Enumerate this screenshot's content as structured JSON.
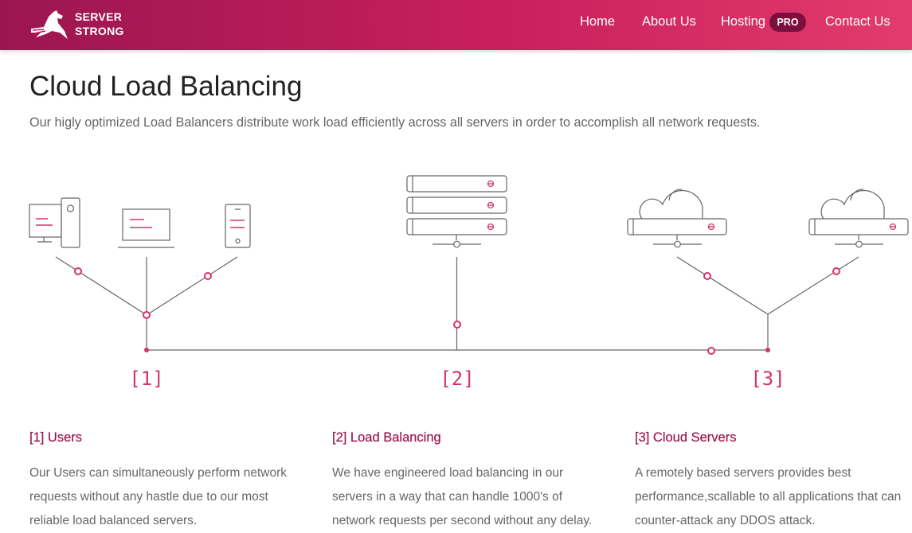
{
  "brand": {
    "line1": "SERVER",
    "line2": "STRONG"
  },
  "nav": {
    "home": "Home",
    "about": "About Us",
    "hosting": "Hosting",
    "hosting_badge": "PRO",
    "contact": "Contact Us"
  },
  "hero": {
    "title": "Cloud Load Balancing",
    "subtitle": "Our higly optimized Load Balancers distribute work load efficiently across all servers in order to accomplish all network requests."
  },
  "diagram": {
    "markers": [
      "[1]",
      "[2]",
      "[3]"
    ],
    "icons": [
      "desktop-icon",
      "laptop-icon",
      "mobile-icon",
      "server-rack-icon",
      "cloud-server-icon"
    ],
    "colors": {
      "accent": "#d6336c",
      "line": "#666666",
      "brand_dark": "#9b1650"
    }
  },
  "sections": [
    {
      "heading": "[1] Users",
      "body": "Our Users can simultaneously perform network requests without any hastle due to our most reliable load balanced servers."
    },
    {
      "heading": "[2] Load Balancing",
      "body": "We have engineered load balancing in our servers in a way that can handle 1000's of network requests per second without any delay."
    },
    {
      "heading": "[3] Cloud Servers",
      "body": "A remotely based servers provides best performance,scallable to all applications that can counter-attack any DDOS attack."
    }
  ]
}
